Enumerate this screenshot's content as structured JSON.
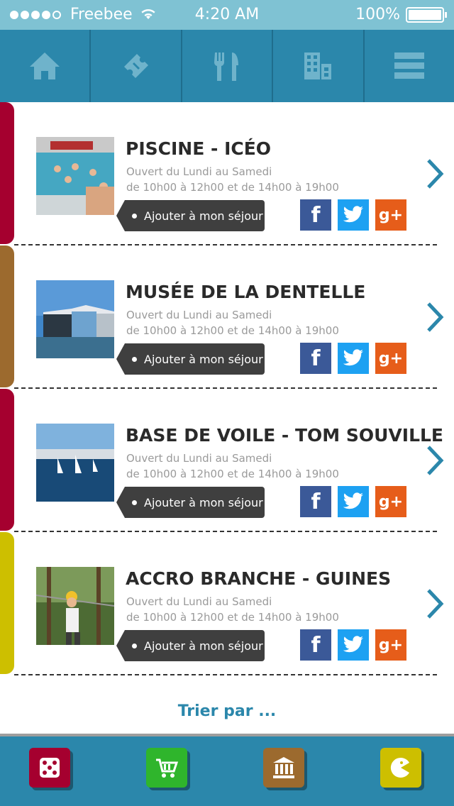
{
  "status_bar": {
    "carrier": "Freebee",
    "time": "4:20 AM",
    "battery": "100%"
  },
  "top_nav": [
    {
      "icon": "home-icon"
    },
    {
      "icon": "ticket-icon"
    },
    {
      "icon": "fork-knife-icon"
    },
    {
      "icon": "building-icon"
    },
    {
      "icon": "menu-icon"
    }
  ],
  "items": [
    {
      "title": "PISCINE - ICÉO",
      "hours_line1": "Ouvert du Lundi au Samedi",
      "hours_line2": "de 10h00 à 12h00 et de 14h00 à 19h00",
      "add_label": "Ajouter à mon séjour",
      "category_color": "#a5002f"
    },
    {
      "title": "MUSÉE DE LA DENTELLE",
      "hours_line1": "Ouvert du Lundi au Samedi",
      "hours_line2": "de 10h00 à 12h00 et de 14h00 à 19h00",
      "add_label": "Ajouter à mon séjour",
      "category_color": "#9c6a2e"
    },
    {
      "title": "BASE DE VOILE - TOM SOUVILLE",
      "hours_line1": "Ouvert du Lundi au Samedi",
      "hours_line2": "de 10h00 à 12h00 et de 14h00 à 19h00",
      "add_label": "Ajouter à mon séjour",
      "category_color": "#a5002f"
    },
    {
      "title": "ACCRO BRANCHE - GUINES",
      "hours_line1": "Ouvert du Lundi au Samedi",
      "hours_line2": "de 10h00 à 12h00 et de 14h00 à 19h00",
      "add_label": "Ajouter à mon séjour",
      "category_color": "#cdbf00"
    }
  ],
  "share": {
    "facebook_label": "f",
    "googleplus_label": "g+"
  },
  "sort_label": "Trier par ...",
  "bottom_nav": [
    {
      "icon": "dice-icon",
      "color": "#a5002f"
    },
    {
      "icon": "cart-icon",
      "color": "#2fb52c"
    },
    {
      "icon": "museum-icon",
      "color": "#9c6a2e"
    },
    {
      "icon": "pacman-icon",
      "color": "#cdbf00"
    }
  ],
  "colors": {
    "accent": "#2b87ab",
    "status_bar": "#7fc2d3"
  }
}
